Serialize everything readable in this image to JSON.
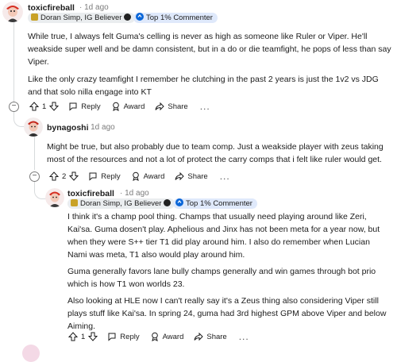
{
  "comment1": {
    "username": "toxicfireball",
    "age": "1d ago",
    "flair": "Doran Simp, IG Believer",
    "badge": "Top 1% Commenter",
    "paragraphs": [
      "While true, I always felt Guma's celling is never as high as someone like Ruler or Viper. He'll weakside super well and be damn consistent, but in a do or die teamfight, he pops of less than say Viper.",
      "Like the only crazy teamfight I remember he clutching in the past 2 years is just the 1v2 vs JDG and that solo nilla engage into KT"
    ],
    "votes": "1",
    "actions": {
      "reply": "Reply",
      "award": "Award",
      "share": "Share",
      "more": "..."
    }
  },
  "comment2": {
    "username": "bynagoshi",
    "age": "1d ago",
    "paragraphs": [
      "Might be true, but also probably due to team comp. Just a weakside player with zeus taking most of the resources and not a lot of protect the carry comps that i felt like ruler would get."
    ],
    "votes": "2",
    "actions": {
      "reply": "Reply",
      "award": "Award",
      "share": "Share",
      "more": "..."
    }
  },
  "comment3": {
    "username": "toxicfireball",
    "age": "1d ago",
    "flair": "Doran Simp, IG Believer",
    "badge": "Top 1% Commenter",
    "paragraphs": [
      "I think it's a champ pool thing. Champs that usually need playing around like Zeri, Kai'sa. Guma dosen't play. Aphelious and Jinx has not been meta for a year now, but when they were S++ tier T1 did play around him. I also do remember when Lucian Nami was meta, T1 also would play around him.",
      "Guma generally favors lane bully champs generally and win games through bot prio which is how T1 won worlds 23.",
      "Also looking at HLE now I can't really say it's a Zeus thing also considering Viper still plays stuff like Kai'sa. In spring 24, guma had 3rd highest GPM above Viper and below Aiming."
    ],
    "votes": "1",
    "actions": {
      "reply": "Reply",
      "award": "Award",
      "share": "Share",
      "more": "..."
    }
  },
  "colors": {
    "text": "#1c1c1c",
    "meta": "#7c7c7c",
    "rail": "#d7dadc",
    "flair_bg": "#eaedef",
    "badge_bg": "#dfe9fb",
    "badge_icon": "#0a66d8"
  }
}
